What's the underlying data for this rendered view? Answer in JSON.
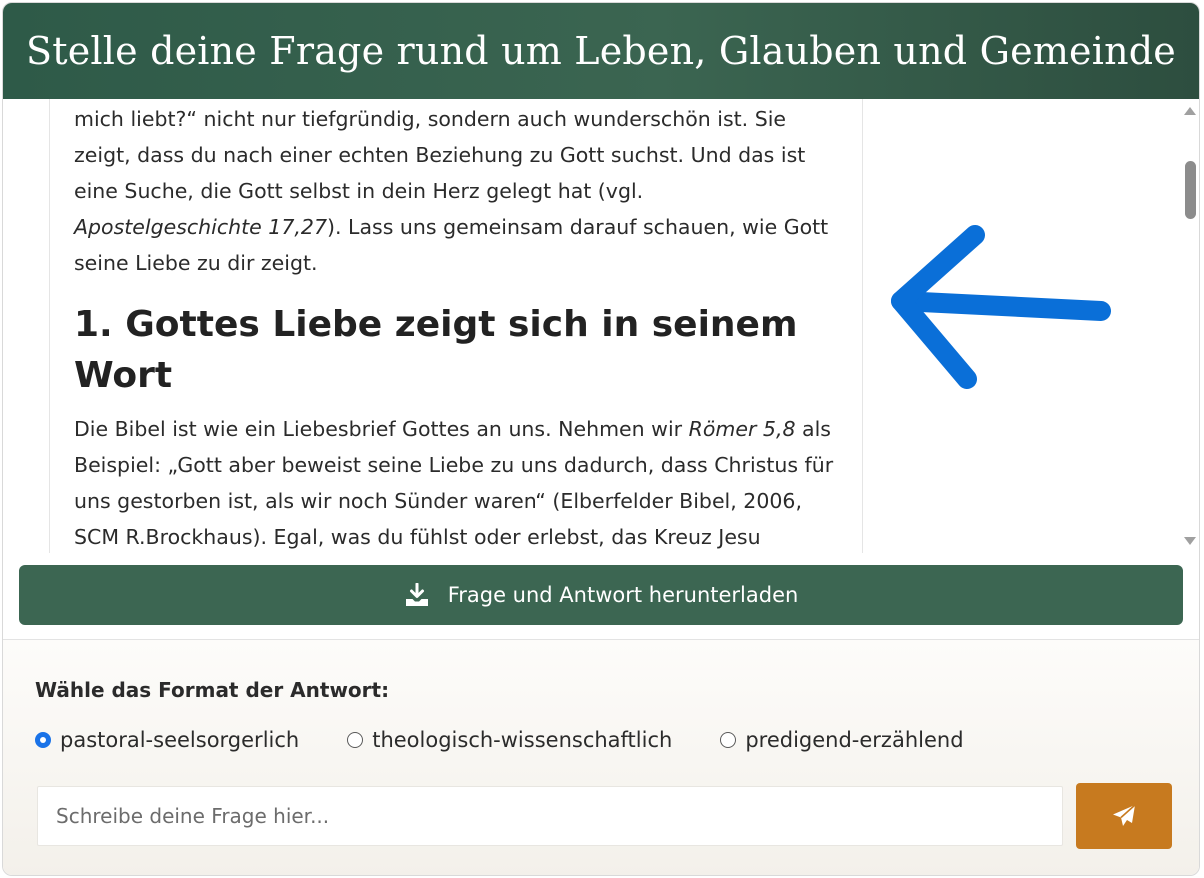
{
  "header": {
    "title": "Stelle deine Frage rund um Leben, Glauben und Gemeinde"
  },
  "answer": {
    "intro_line1": "mich liebt?“ nicht nur tiefgründig, sondern auch wunderschön ist. Sie",
    "intro_line2": "zeigt, dass du nach einer echten Beziehung zu Gott suchst. Und das ist",
    "intro_line3": "eine Suche, die Gott selbst in dein Herz gelegt hat (vgl.",
    "intro_ref": "Apostelgeschichte 17,27",
    "intro_line4_rest": "). Lass uns gemeinsam darauf schauen, wie Gott",
    "intro_line5": "seine Liebe zu dir zeigt.",
    "heading": "1. Gottes Liebe zeigt sich in seinem Wort",
    "para2_start": "Die Bibel ist wie ein Liebesbrief Gottes an uns. Nehmen wir ",
    "para2_ref": "Römer 5,8",
    "para2_rest": " als Beispiel: „Gott aber beweist seine Liebe zu uns dadurch, dass Christus für uns gestorben ist, als wir noch Sünder waren“ (Elberfelder Bibel, 2006, SCM R.Brockhaus). Egal, was du fühlst oder erlebst, das Kreuz Jesu"
  },
  "download": {
    "label": "Frage und Antwort herunterladen",
    "icon": "download-icon"
  },
  "format": {
    "label": "Wähle das Format der Antwort:",
    "options": [
      {
        "label": "pastoral-seelsorgerlich",
        "checked": true
      },
      {
        "label": "theologisch-wissenschaftlich",
        "checked": false
      },
      {
        "label": "predigend-erzählend",
        "checked": false
      }
    ]
  },
  "input": {
    "placeholder": "Schreibe deine Frage hier...",
    "value": ""
  },
  "send": {
    "icon": "paper-plane-icon"
  },
  "colors": {
    "header_bg": "#3b6551",
    "download_bg": "#3c6652",
    "send_bg": "#c77a1f",
    "radio_checked": "#1a73e8",
    "annotation_arrow": "#0a6fd8"
  }
}
